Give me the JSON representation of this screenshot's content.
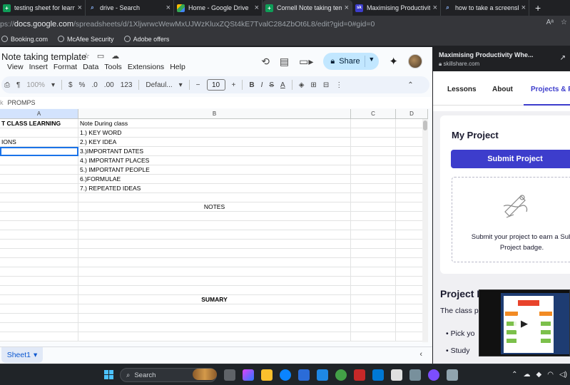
{
  "browser": {
    "tabs": [
      {
        "title": "testing sheet for learning",
        "icon": "sheets-icon",
        "color": "#0f9d58",
        "active": false
      },
      {
        "title": "drive - Search",
        "icon": "search-icon",
        "color": "#8ab4f8",
        "active": false
      },
      {
        "title": "Home - Google Drive",
        "icon": "drive-icon",
        "color": "#fbbc04",
        "active": false
      },
      {
        "title": "Cornell Note taking temp",
        "icon": "sheets-icon",
        "color": "#0f9d58",
        "active": true
      },
      {
        "title": "Maximising Productivity W",
        "icon": "skillshare-icon",
        "color": "#3d3dcc",
        "active": false
      },
      {
        "title": "how to take a screenshot",
        "icon": "search-icon",
        "color": "#8ab4f8",
        "active": false
      }
    ],
    "new_tab": "+",
    "address": {
      "prefix": "ps://",
      "host": "docs.google.com",
      "path": "/spreadsheets/d/1XljwrwcWewMxUJWzKluxZQSt4kE7TvalC284ZbOt6L8/edit?gid=0#gid=0"
    },
    "bookmarks": [
      "Booking.com",
      "McAfee Security",
      "Adobe offers"
    ]
  },
  "sheets": {
    "title": "Note taking template",
    "menu": [
      "View",
      "Insert",
      "Format",
      "Data",
      "Tools",
      "Extensions",
      "Help"
    ],
    "share_label": "Share",
    "toolbar": {
      "zoom": "100%",
      "currency": "$",
      "percent": "%",
      "dec_decrease": ".0",
      "dec_increase": ".00",
      "number_format": "123",
      "font": "Defaul...",
      "font_size": "10",
      "bold": "B",
      "italic": "I",
      "strike": "S",
      "text_color": "A"
    },
    "formula_bar": {
      "fx": "k",
      "content": "PROMPS"
    },
    "columns": [
      "A",
      "B",
      "C",
      "D"
    ],
    "rows": [
      {
        "a": "T CLASS LEARNING",
        "b": "Note During class",
        "a_bold": true
      },
      {
        "a": "",
        "b": "1.) KEY WORD"
      },
      {
        "a": "IONS",
        "b": "2.) KEY IDEA"
      },
      {
        "a": "",
        "b": "3.)IMPORTANT DATES"
      },
      {
        "a": "",
        "b": "4.) IMPORTANT PLACES"
      },
      {
        "a": "",
        "b": "5.) IMPORTANT PEOPLE"
      },
      {
        "a": "",
        "b": "6.)FORMULAE"
      },
      {
        "a": "",
        "b": "7.) REPEATED IDEAS"
      },
      {
        "a": "",
        "b": ""
      },
      {
        "a": "",
        "b": "NOTES",
        "b_center": true
      },
      {
        "a": "",
        "b": ""
      },
      {
        "a": "",
        "b": ""
      },
      {
        "a": "",
        "b": ""
      },
      {
        "a": "",
        "b": ""
      },
      {
        "a": "",
        "b": ""
      },
      {
        "a": "",
        "b": ""
      },
      {
        "a": "",
        "b": ""
      },
      {
        "a": "",
        "b": ""
      },
      {
        "a": "",
        "b": ""
      },
      {
        "a": "",
        "b": "SUMARY",
        "b_center": true,
        "b_bold": true
      },
      {
        "a": "",
        "b": ""
      },
      {
        "a": "",
        "b": ""
      },
      {
        "a": "",
        "b": ""
      },
      {
        "a": "",
        "b": ""
      }
    ],
    "sheet_tab": "Sheet1"
  },
  "panel": {
    "title": "Maximising Productivity Whe...",
    "url": "skillshare.com",
    "tabs": [
      "Lessons",
      "About",
      "Projects & R"
    ],
    "my_project": "My Project",
    "submit_label": "Submit Project",
    "dropzone_line1": "Submit your project to earn a Sub",
    "dropzone_line2": "Project badge.",
    "project_heading": "Project I",
    "project_desc": "The class p",
    "bullets": [
      "Pick yo",
      "Study"
    ]
  },
  "taskbar": {
    "search_placeholder": "Search"
  }
}
